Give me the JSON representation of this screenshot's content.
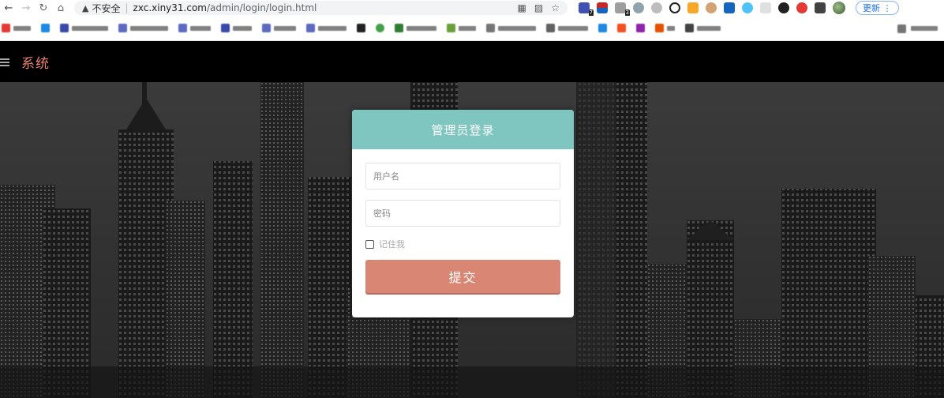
{
  "browser": {
    "security_label": "不安全",
    "url_host": "zxc.xiny31.com",
    "url_path": "/admin/login/login.html",
    "update_label": "更新",
    "extension_badges": [
      "7",
      "3"
    ]
  },
  "app": {
    "title": "系统",
    "accent_color": "#e8826d"
  },
  "login": {
    "header": "管理员登录",
    "header_color": "#7fc6c0",
    "username_placeholder": "用户名",
    "password_placeholder": "密码",
    "remember_label": "记住我",
    "submit_label": "提交",
    "submit_color": "#da8675"
  }
}
